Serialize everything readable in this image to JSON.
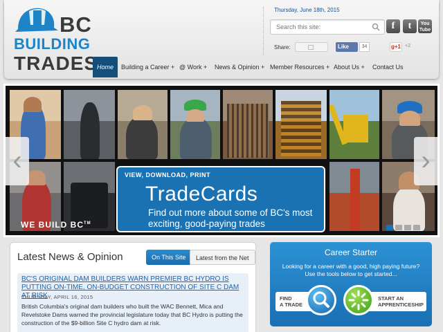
{
  "header": {
    "logo": {
      "line1": "BC",
      "line2": "BUILDING",
      "line3": "TRADES"
    },
    "date": "Thursday, June 18th, 2015",
    "search": {
      "placeholder": "Search this site:"
    },
    "social_icons": [
      {
        "name": "facebook-icon",
        "glyph": "f"
      },
      {
        "name": "twitter-icon",
        "glyph": "t"
      },
      {
        "name": "youtube-icon",
        "glyph": "You Tube"
      }
    ],
    "share": {
      "label": "Share:",
      "like_label": "Like",
      "like_count": "34",
      "gplus_label": "g+1",
      "gplus_count": "+2"
    }
  },
  "nav": {
    "items": [
      {
        "label": "Home",
        "active": true
      },
      {
        "label": "Building a Career +"
      },
      {
        "label": "@ Work +"
      },
      {
        "label": "News & Opinion +"
      },
      {
        "label": "Member Resources +"
      },
      {
        "label": "About Us +"
      },
      {
        "label": "Contact Us"
      }
    ]
  },
  "banner": {
    "small": "VIEW, DOWNLOAD, PRINT",
    "title": "TradeCards",
    "subtitle": "Find out more about some of BC's most exciting, good-paying trades",
    "footer_text": "WE BUILD BC",
    "trademark": "TM",
    "slide_count": 4,
    "active_slide": 1,
    "prev_glyph": "‹",
    "next_glyph": "›"
  },
  "news": {
    "title": "Latest News & Opinion",
    "tabs": [
      "On This Site",
      "Latest from the Net"
    ],
    "article": {
      "headline": "BC'S ORIGINAL DAM BUILDERS WARN PREMIER BC HYDRO IS PUTTING ON-TIME, ON-BUDGET CONSTRUCTION OF SITE C DAM AT RISK",
      "date": "THURSDAY, APRIL 16, 2015",
      "body": "British Columbia's original dam builders who built the WAC Bennett, Mica and Revelstoke Dams warned the provincial legislature today that BC Hydro is putting the construction of the $9-billion Site C hydro dam at risk."
    }
  },
  "career": {
    "title": "Career Starter",
    "text": "Looking for a career with a good, high paying future? Use the tools below to get started...",
    "find_line1": "FIND",
    "find_line2": "A TRADE",
    "start_line1": "START AN",
    "start_line2": "APPRENTICESHIP"
  },
  "colors": {
    "brand_blue": "#1f84c5",
    "nav_active": "#144f7b",
    "tradecards_blue": "#1b72b2"
  }
}
